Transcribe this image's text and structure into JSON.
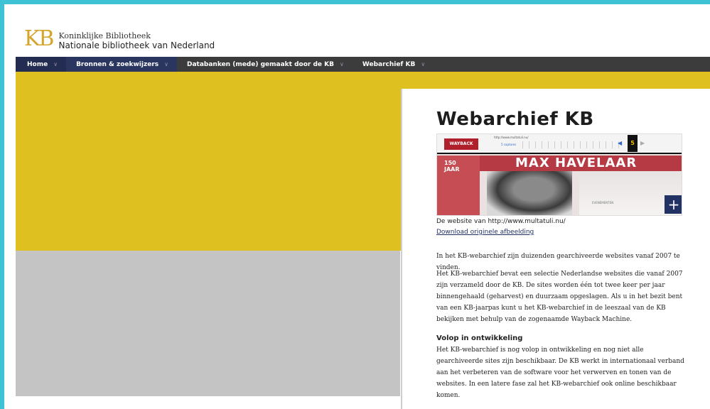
{
  "header": {
    "logo_mark": "KB",
    "logo_line1": "Koninklijke Bibliotheek",
    "logo_line2": "Nationale bibliotheek van Nederland"
  },
  "nav": {
    "items": [
      {
        "label": "Home"
      },
      {
        "label": "Bronnen & zoekwijzers"
      },
      {
        "label": "Databanken (mede) gemaakt door de KB"
      },
      {
        "label": "Webarchief KB"
      }
    ]
  },
  "main": {
    "title": "Webarchief KB",
    "image": {
      "url_text": "http://www.multatuli.nu/",
      "captures_text": "5 captures",
      "calendar_day": "5",
      "badge_line1": "150",
      "badge_line2": "JAAR",
      "banner_text": "MAX HAVELAAR",
      "small_text": "EVENEMENTEN"
    },
    "caption": "De website van http://www.multatuli.nu/",
    "download_link": "Download originele afbeelding",
    "p1": "In het KB-webarchief zijn duizenden gearchiveerde websites vanaf 2007 te vinden.",
    "p2": "Het KB-webarchief bevat een selectie Nederlandse websites die vanaf 2007 zijn verzameld door de KB. De sites worden één tot twee keer per jaar binnengehaald (geharvest) en duurzaam opgeslagen. Als u in het bezit bent van een KB-jaarpas kunt u het KB-webarchief in de leeszaal van de KB bekijken met behulp van de zogenaamde Wayback Machine.",
    "section_heading": "Volop in ontwikkeling",
    "p3": "Het KB-webarchief is nog volop in ontwikkeling en nog niet alle gearchiveerde sites zijn beschikbaar. De KB werkt in internationaal verband aan het verbeteren van de software voor het verwerven en tonen van de websites. In een latere fase zal het KB-webarchief ook online beschikbaar komen."
  },
  "colors": {
    "accent_blue": "#233264",
    "banner_yellow": "#dfc021",
    "logo_gold": "#d4a52b"
  }
}
